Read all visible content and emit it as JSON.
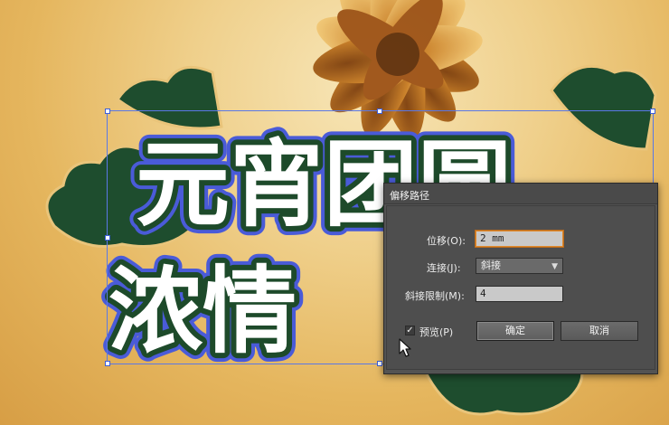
{
  "dialog": {
    "title": "偏移路径",
    "offset": {
      "label": "位移(O):",
      "value": "2 mm"
    },
    "joins": {
      "label": "连接(J):",
      "value": "斜接"
    },
    "miter_limit": {
      "label": "斜接限制(M):",
      "value": "4"
    },
    "preview": {
      "label": "预览(P)",
      "checked": true,
      "check_glyph": "✓"
    },
    "ok_label": "确定",
    "cancel_label": "取消"
  },
  "artwork": {
    "line1": "元宵团圆",
    "line2": "浓情",
    "text_fill": "#ffffff",
    "text_stroke": "#1d4a2a",
    "path_color": "#4a5bd8",
    "accent": "#e08a2d"
  },
  "icons": [
    "flower-illustration",
    "cloud-decoration",
    "mouse-pointer-icon",
    "dropdown-arrow-icon",
    "checkmark-icon"
  ]
}
